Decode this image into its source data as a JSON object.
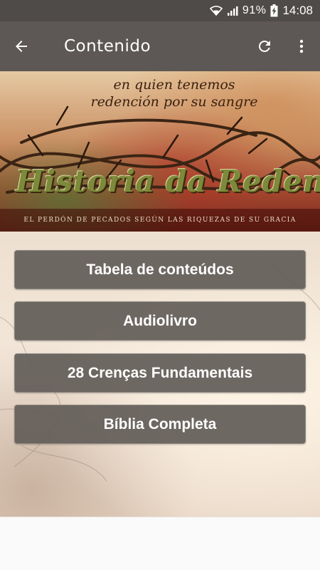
{
  "status_bar": {
    "battery": "91%",
    "time": "14:08",
    "icons": [
      "wifi-icon",
      "signal-icon",
      "battery-charging-icon"
    ]
  },
  "app_bar": {
    "title": "Contenido",
    "icons": [
      "back-arrow-icon",
      "refresh-icon",
      "more-vert-icon"
    ]
  },
  "banner": {
    "tagline_line1": "en quien tenemos",
    "tagline_line2": "redención por su sangre",
    "title": "Historia da Redenção",
    "caption": "EL PERDÓN DE PECADOS SEGÚN LAS RIQUEZAS DE SU GRACIA"
  },
  "menu": {
    "items": [
      {
        "label": "Tabela de conteúdos"
      },
      {
        "label": "Audiolivro"
      },
      {
        "label": "28 Crenças Fundamentais"
      },
      {
        "label": "Bíblia Completa"
      }
    ]
  },
  "colors": {
    "status_bar": "#4f4b48",
    "app_bar": "#5d5855",
    "button_bg": "#625c58",
    "button_text": "#ffffff"
  }
}
